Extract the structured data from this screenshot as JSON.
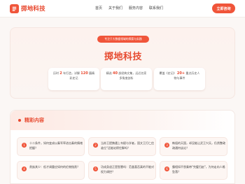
{
  "brand": {
    "name": "掷地科技"
  },
  "nav": {
    "items": [
      "首页",
      "关于我们",
      "服务内容",
      "联系我们"
    ]
  },
  "header": {
    "cta_label": "立即咨询"
  },
  "hero": {
    "badge": "专注于大数据领域的探索与实践",
    "title": "掷地科技",
    "stats": [
      {
        "pre": "历时",
        "num": "2",
        "mid": "年打造，详解",
        "num2": "120",
        "post": "篇精彩史记"
      },
      {
        "pre": "精选",
        "num": "40",
        "mid": "部经典文集，远近名家多角度剖析",
        "num2": "",
        "post": ""
      },
      {
        "pre": "覆盖《史记》",
        "num": "20+",
        "mid": "重点历史人物与事件",
        "num2": "",
        "post": ""
      }
    ]
  },
  "section": {
    "title": "精彩内容",
    "items": [
      {
        "index": "1",
        "text": "十二条件，如何变成以秦军率进击秦的情绪把握？"
      },
      {
        "index": "2",
        "text": "当苏王提携遇上韦赋与学者，国文王打仁信谁位\"还能站得住脚吗？"
      },
      {
        "index": "3",
        "text": "韩祖的天国，却没能让武王兴兵，仍然整政疏通何谈论？"
      },
      {
        "index": "4",
        "text": "贵族其少：低才调重应如何的伦物指责？"
      },
      {
        "index": "5",
        "text": "功成身退正是智慧吗：范蠡喜否真的不能对权力调控？"
      },
      {
        "index": "6",
        "text": "霸相如不畏秦带\"完璧归赵\"，为何走向人格坠落？"
      }
    ]
  }
}
